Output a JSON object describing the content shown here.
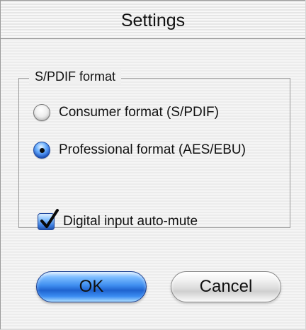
{
  "window": {
    "title": "Settings"
  },
  "spdif_group": {
    "label": "S/PDIF format",
    "options": [
      {
        "label": "Consumer format (S/PDIF)",
        "selected": false
      },
      {
        "label": "Professional format (AES/EBU)",
        "selected": true
      }
    ]
  },
  "auto_mute": {
    "label": "Digital input auto-mute",
    "checked": true
  },
  "buttons": {
    "ok_label": "OK",
    "cancel_label": "Cancel"
  },
  "colors": {
    "accent": "#2563d8",
    "default_button": "#3f8ef0"
  },
  "icons": {
    "checkmark": "checkmark-icon"
  }
}
